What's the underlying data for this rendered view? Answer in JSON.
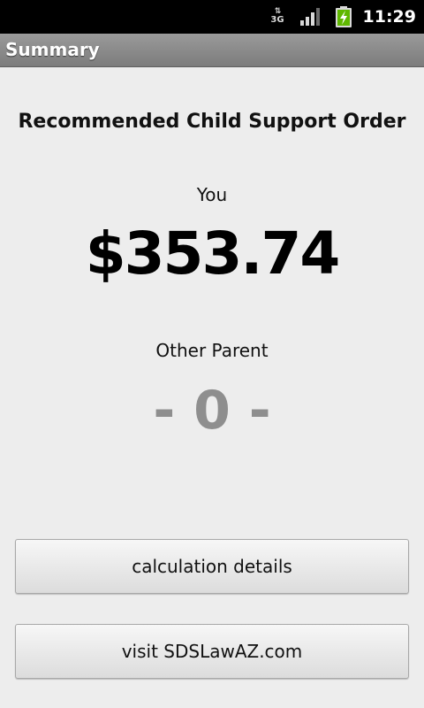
{
  "status_bar": {
    "network": "3G",
    "time": "11:29"
  },
  "title_bar": {
    "title": "Summary"
  },
  "summary": {
    "heading": "Recommended Child Support Order",
    "you_label": "You",
    "you_amount": "$353.74",
    "other_parent_label": "Other Parent",
    "other_parent_amount": "- 0 -"
  },
  "buttons": {
    "details_label": "calculation details",
    "visit_label": "visit SDSLawAZ.com"
  }
}
